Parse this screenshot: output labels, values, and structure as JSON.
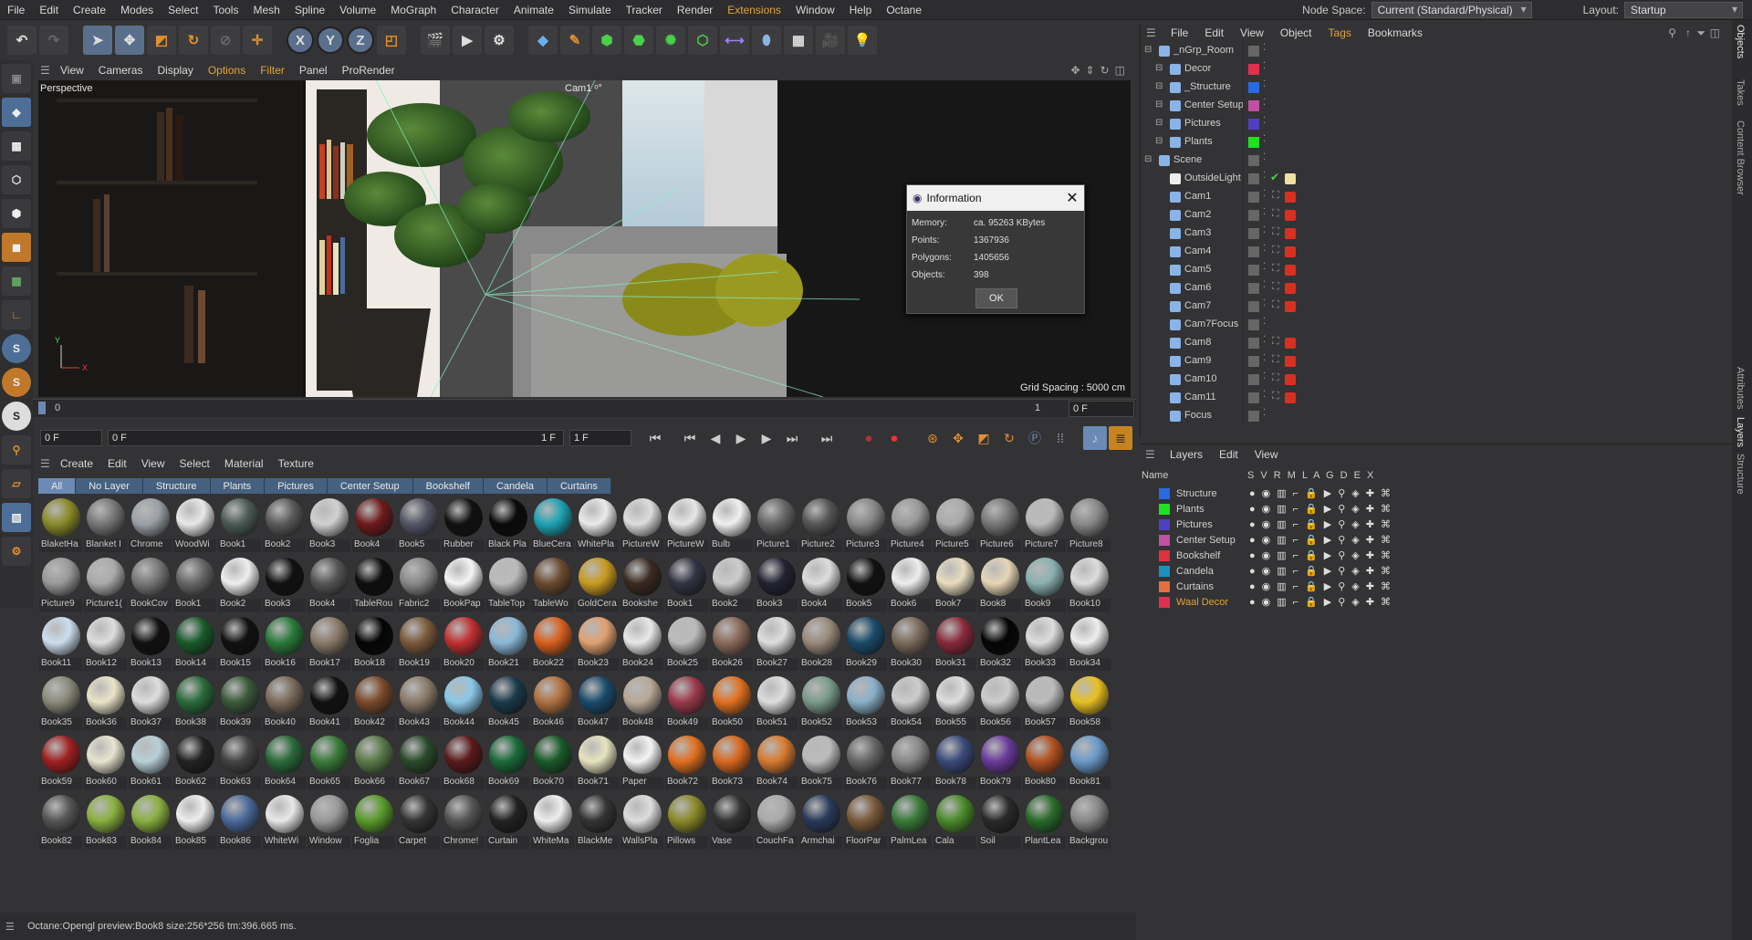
{
  "menubar": {
    "items": [
      "File",
      "Edit",
      "Create",
      "Modes",
      "Select",
      "Tools",
      "Mesh",
      "Spline",
      "Volume",
      "MoGraph",
      "Character",
      "Animate",
      "Simulate",
      "Tracker",
      "Render",
      "Extensions",
      "Window",
      "Help",
      "Octane"
    ],
    "node_space_label": "Node Space:",
    "node_space_value": "Current (Standard/Physical)",
    "layout_label": "Layout:",
    "layout_value": "Startup"
  },
  "viewport": {
    "menu": [
      "View",
      "Cameras",
      "Display",
      "Options",
      "Filter",
      "Panel",
      "ProRender"
    ],
    "perspective_label": "Perspective",
    "camera_label": "Cam1 ᵒ°",
    "grid_spacing": "Grid Spacing : 5000 cm"
  },
  "info_dialog": {
    "title": "Information",
    "rows": [
      {
        "key": "Memory:",
        "value": "ca. 95263 KBytes"
      },
      {
        "key": "Points:",
        "value": "1367936"
      },
      {
        "key": "Polygons:",
        "value": "1405656"
      },
      {
        "key": "Objects:",
        "value": "398"
      }
    ],
    "ok_label": "OK"
  },
  "timeline": {
    "start": "0",
    "end": "1",
    "current": "0 F",
    "field_start": "0 F",
    "field_range_start": "0 F",
    "field_range_end": "1 F",
    "field_end": "1 F"
  },
  "material_manager": {
    "menu": [
      "Create",
      "Edit",
      "View",
      "Select",
      "Material",
      "Texture"
    ],
    "tabs": [
      "All",
      "No Layer",
      "Structure",
      "Plants",
      "Pictures",
      "Center Setup",
      "Bookshelf",
      "Candela",
      "Curtains"
    ],
    "active_tab": "All",
    "materials": [
      {
        "n": "BlaketHa",
        "c": "#8a8a2a"
      },
      {
        "n": "Blanket I",
        "c": "#777"
      },
      {
        "n": "Chrome",
        "c": "#9aa0a6"
      },
      {
        "n": "WoodWi",
        "c": "#e8e8e8"
      },
      {
        "n": "Book1",
        "c": "#4b5a55"
      },
      {
        "n": "Book2",
        "c": "#5a5a5a"
      },
      {
        "n": "Book3",
        "c": "#d0d0d0"
      },
      {
        "n": "Book4",
        "c": "#6e1a1a"
      },
      {
        "n": "Book5",
        "c": "#556"
      },
      {
        "n": "Rubber",
        "c": "#111"
      },
      {
        "n": "Black Pla",
        "c": "#0a0a0a"
      },
      {
        "n": "BlueCera",
        "c": "#1ea3b3"
      },
      {
        "n": "WhitePla",
        "c": "#eaeaea"
      },
      {
        "n": "PictureW",
        "c": "#dcdcdc"
      },
      {
        "n": "PictureW",
        "c": "#e6e6e6"
      },
      {
        "n": "Bulb",
        "c": "#f0f0f0"
      },
      {
        "n": "Picture1",
        "c": "#666"
      },
      {
        "n": "Picture2",
        "c": "#555"
      },
      {
        "n": "Picture3",
        "c": "#888"
      },
      {
        "n": "Picture4",
        "c": "#999"
      },
      {
        "n": "Picture5",
        "c": "#aaa"
      },
      {
        "n": "Picture6",
        "c": "#777"
      },
      {
        "n": "Picture7",
        "c": "#bbb"
      },
      {
        "n": "Picture8",
        "c": "#888"
      },
      {
        "n": "Picture9",
        "c": "#999"
      },
      {
        "n": "Picture1(",
        "c": "#aaa"
      },
      {
        "n": "BookCov",
        "c": "#777"
      },
      {
        "n": "Book1",
        "c": "#666"
      },
      {
        "n": "Book2",
        "c": "#eee"
      },
      {
        "n": "Book3",
        "c": "#111"
      },
      {
        "n": "Book4",
        "c": "#555"
      },
      {
        "n": "TableRou",
        "c": "#0e0e0e"
      },
      {
        "n": "Fabric2",
        "c": "#888"
      },
      {
        "n": "BookPap",
        "c": "#f4f4f4"
      },
      {
        "n": "TableTop",
        "c": "#bbb"
      },
      {
        "n": "TableWo",
        "c": "#6a4a30"
      },
      {
        "n": "GoldCera",
        "c": "#c89a20"
      },
      {
        "n": "Bookshe",
        "c": "#3a2a20"
      },
      {
        "n": "Book1",
        "c": "#334"
      },
      {
        "n": "Book2",
        "c": "#ccc"
      },
      {
        "n": "Book3",
        "c": "#223"
      },
      {
        "n": "Book4",
        "c": "#ddd"
      },
      {
        "n": "Book5",
        "c": "#111"
      },
      {
        "n": "Book6",
        "c": "#eee"
      },
      {
        "n": "Book7",
        "c": "#e8dcc0"
      },
      {
        "n": "Book8",
        "c": "#e6d6b6"
      },
      {
        "n": "Book9",
        "c": "#8ab0b0"
      },
      {
        "n": "Book10",
        "c": "#ddd"
      },
      {
        "n": "Book11",
        "c": "#cde"
      },
      {
        "n": "Book12",
        "c": "#ddd"
      },
      {
        "n": "Book13",
        "c": "#111"
      },
      {
        "n": "Book14",
        "c": "#1a5a2a"
      },
      {
        "n": "Book15",
        "c": "#111"
      },
      {
        "n": "Book16",
        "c": "#2a7a3a"
      },
      {
        "n": "Book17",
        "c": "#8a7a6a"
      },
      {
        "n": "Book18",
        "c": "#050505"
      },
      {
        "n": "Book19",
        "c": "#7a5a3a"
      },
      {
        "n": "Book20",
        "c": "#c03030"
      },
      {
        "n": "Book21",
        "c": "#8ab8d8"
      },
      {
        "n": "Book22",
        "c": "#d86020"
      },
      {
        "n": "Book23",
        "c": "#e0a070"
      },
      {
        "n": "Book24",
        "c": "#e8e8e8"
      },
      {
        "n": "Book25",
        "c": "#bbb"
      },
      {
        "n": "Book26",
        "c": "#8a6a5a"
      },
      {
        "n": "Book27",
        "c": "#ddd"
      },
      {
        "n": "Book28",
        "c": "#9a8a7a"
      },
      {
        "n": "Book29",
        "c": "#1a4a6a"
      },
      {
        "n": "Book30",
        "c": "#7a6a5a"
      },
      {
        "n": "Book31",
        "c": "#8a2a3a"
      },
      {
        "n": "Book32",
        "c": "#050505"
      },
      {
        "n": "Book33",
        "c": "#ddd"
      },
      {
        "n": "Book34",
        "c": "#eee"
      },
      {
        "n": "Book35",
        "c": "#8a8a7a"
      },
      {
        "n": "Book36",
        "c": "#eae4c8"
      },
      {
        "n": "Book37",
        "c": "#ddd"
      },
      {
        "n": "Book38",
        "c": "#2a6a3a"
      },
      {
        "n": "Book39",
        "c": "#3a5a3a"
      },
      {
        "n": "Book40",
        "c": "#7a6a5a"
      },
      {
        "n": "Book41",
        "c": "#111"
      },
      {
        "n": "Book42",
        "c": "#7a4a2a"
      },
      {
        "n": "Book43",
        "c": "#8a7a6a"
      },
      {
        "n": "Book44",
        "c": "#8ac8e8"
      },
      {
        "n": "Book45",
        "c": "#1a3a4a"
      },
      {
        "n": "Book46",
        "c": "#b07040"
      },
      {
        "n": "Book47",
        "c": "#1a4a6a"
      },
      {
        "n": "Book48",
        "c": "#b8a898"
      },
      {
        "n": "Book49",
        "c": "#9a3a4a"
      },
      {
        "n": "Book50",
        "c": "#e07020"
      },
      {
        "n": "Book51",
        "c": "#ddd"
      },
      {
        "n": "Book52",
        "c": "#7a9a8a"
      },
      {
        "n": "Book53",
        "c": "#8ab0c8"
      },
      {
        "n": "Book54",
        "c": "#ccc"
      },
      {
        "n": "Book55",
        "c": "#ddd"
      },
      {
        "n": "Book56",
        "c": "#ccc"
      },
      {
        "n": "Book57",
        "c": "#bbb"
      },
      {
        "n": "Book58",
        "c": "#e8c020"
      },
      {
        "n": "Book59",
        "c": "#a02020"
      },
      {
        "n": "Book60",
        "c": "#e8e4d0"
      },
      {
        "n": "Book61",
        "c": "#b8d0d8"
      },
      {
        "n": "Book62",
        "c": "#222"
      },
      {
        "n": "Book63",
        "c": "#444"
      },
      {
        "n": "Book64",
        "c": "#2a6a3a"
      },
      {
        "n": "Book65",
        "c": "#3a7a3a"
      },
      {
        "n": "Book66",
        "c": "#5a7a4a"
      },
      {
        "n": "Book67",
        "c": "#2a4a2a"
      },
      {
        "n": "Book68",
        "c": "#5a1a1a"
      },
      {
        "n": "Book69",
        "c": "#1a6a3a"
      },
      {
        "n": "Book70",
        "c": "#1a5a2a"
      },
      {
        "n": "Book71",
        "c": "#e8e4c0"
      },
      {
        "n": "Paper",
        "c": "#f4f4f4"
      },
      {
        "n": "Book72",
        "c": "#e07020"
      },
      {
        "n": "Book73",
        "c": "#d86820"
      },
      {
        "n": "Book74",
        "c": "#d87a30"
      },
      {
        "n": "Book75",
        "c": "#bbb"
      },
      {
        "n": "Book76",
        "c": "#666"
      },
      {
        "n": "Book77",
        "c": "#888"
      },
      {
        "n": "Book78",
        "c": "#3a4a7a"
      },
      {
        "n": "Book79",
        "c": "#6a3a9a"
      },
      {
        "n": "Book80",
        "c": "#b05020"
      },
      {
        "n": "Book81",
        "c": "#6a9ac8"
      },
      {
        "n": "Book82",
        "c": "#555"
      },
      {
        "n": "Book83",
        "c": "#8ab040"
      },
      {
        "n": "Book84",
        "c": "#8ab040"
      },
      {
        "n": "Book85",
        "c": "#eee"
      },
      {
        "n": "Book86",
        "c": "#4a6a9a"
      },
      {
        "n": "WhiteWi",
        "c": "#e8e8e8"
      },
      {
        "n": "Window",
        "c": "#999"
      },
      {
        "n": "Foglia",
        "c": "#5a9a2a"
      },
      {
        "n": "Carpet",
        "c": "#333"
      },
      {
        "n": "Chrome!",
        "c": "#555"
      },
      {
        "n": "Curtain",
        "c": "#222"
      },
      {
        "n": "WhiteMa",
        "c": "#eee"
      },
      {
        "n": "BlackMe",
        "c": "#333"
      },
      {
        "n": "WallsPla",
        "c": "#ddd"
      },
      {
        "n": "Pillows",
        "c": "#8a8a2a"
      },
      {
        "n": "Vase",
        "c": "#333"
      },
      {
        "n": "CouchFa",
        "c": "#aaa"
      },
      {
        "n": "Armchai",
        "c": "#2a3a5a"
      },
      {
        "n": "FloorPar",
        "c": "#7a5a3a"
      },
      {
        "n": "PalmLea",
        "c": "#3a7a3a"
      },
      {
        "n": "Cala",
        "c": "#4a8a2a"
      },
      {
        "n": "Soil",
        "c": "#2a2a2a"
      },
      {
        "n": "PlantLea",
        "c": "#2a6a2a"
      },
      {
        "n": "Backgrou",
        "c": "#888"
      }
    ]
  },
  "status": {
    "text": "Octane:Opengl preview:Book8  size:256*256  tm:396.665 ms."
  },
  "object_manager": {
    "menu": [
      "File",
      "Edit",
      "View",
      "Object",
      "Tags",
      "Bookmarks"
    ],
    "objects": [
      {
        "name": "_nGrp_Room",
        "indent": 0,
        "color": "#555",
        "icon": "#8ab4e8",
        "tag": ""
      },
      {
        "name": "Decor",
        "indent": 1,
        "color": "#e03050",
        "icon": "#8ab4e8",
        "tag": ""
      },
      {
        "name": "_Structure",
        "indent": 1,
        "color": "#2a6ae0",
        "icon": "#8ab4e8",
        "tag": ""
      },
      {
        "name": "Center Setup",
        "indent": 1,
        "color": "#c050a0",
        "icon": "#8ab4e8",
        "tag": ""
      },
      {
        "name": "Pictures",
        "indent": 1,
        "color": "#5040c0",
        "icon": "#8ab4e8",
        "tag": ""
      },
      {
        "name": "Plants",
        "indent": 1,
        "color": "#20e020",
        "icon": "#8ab4e8",
        "tag": ""
      },
      {
        "name": "Scene",
        "indent": 0,
        "color": "#555",
        "icon": "#8ab4e8",
        "tag": ""
      },
      {
        "name": "OutsideLight",
        "indent": 1,
        "color": "#555",
        "icon": "#eee",
        "tag": "light"
      },
      {
        "name": "Cam1",
        "indent": 1,
        "color": "#555",
        "icon": "#8ab4e8",
        "tag": "cam"
      },
      {
        "name": "Cam2",
        "indent": 1,
        "color": "#555",
        "icon": "#8ab4e8",
        "tag": "cam"
      },
      {
        "name": "Cam3",
        "indent": 1,
        "color": "#555",
        "icon": "#8ab4e8",
        "tag": "cam"
      },
      {
        "name": "Cam4",
        "indent": 1,
        "color": "#555",
        "icon": "#8ab4e8",
        "tag": "cam"
      },
      {
        "name": "Cam5",
        "indent": 1,
        "color": "#555",
        "icon": "#8ab4e8",
        "tag": "cam"
      },
      {
        "name": "Cam6",
        "indent": 1,
        "color": "#555",
        "icon": "#8ab4e8",
        "tag": "cam"
      },
      {
        "name": "Cam7",
        "indent": 1,
        "color": "#555",
        "icon": "#8ab4e8",
        "tag": "cam"
      },
      {
        "name": "Cam7Focus",
        "indent": 1,
        "color": "#555",
        "icon": "#8ab4e8",
        "tag": ""
      },
      {
        "name": "Cam8",
        "indent": 1,
        "color": "#555",
        "icon": "#8ab4e8",
        "tag": "cam"
      },
      {
        "name": "Cam9",
        "indent": 1,
        "color": "#555",
        "icon": "#8ab4e8",
        "tag": "cam"
      },
      {
        "name": "Cam10",
        "indent": 1,
        "color": "#555",
        "icon": "#8ab4e8",
        "tag": "cam"
      },
      {
        "name": "Cam11",
        "indent": 1,
        "color": "#555",
        "icon": "#8ab4e8",
        "tag": "cam"
      },
      {
        "name": "Focus",
        "indent": 1,
        "color": "#555",
        "icon": "#8ab4e8",
        "tag": ""
      }
    ]
  },
  "layer_manager": {
    "menu": [
      "Layers",
      "Edit",
      "View"
    ],
    "header_name": "Name",
    "header_cols": "S V R M L A G D E X",
    "layers": [
      {
        "name": "Structure",
        "color": "#2a6ae0"
      },
      {
        "name": "Plants",
        "color": "#20e020"
      },
      {
        "name": "Pictures",
        "color": "#5040c0"
      },
      {
        "name": "Center Setup",
        "color": "#c050a0"
      },
      {
        "name": "Bookshelf",
        "color": "#e03040"
      },
      {
        "name": "Candela",
        "color": "#1e90c0"
      },
      {
        "name": "Curtains",
        "color": "#e07040"
      },
      {
        "name": "Waal Decor",
        "color": "#e03050",
        "highlight": true
      }
    ]
  },
  "right_tabs": [
    "Objects",
    "Takes",
    "Content Browser",
    "Attributes",
    "Layers",
    "Structure"
  ]
}
